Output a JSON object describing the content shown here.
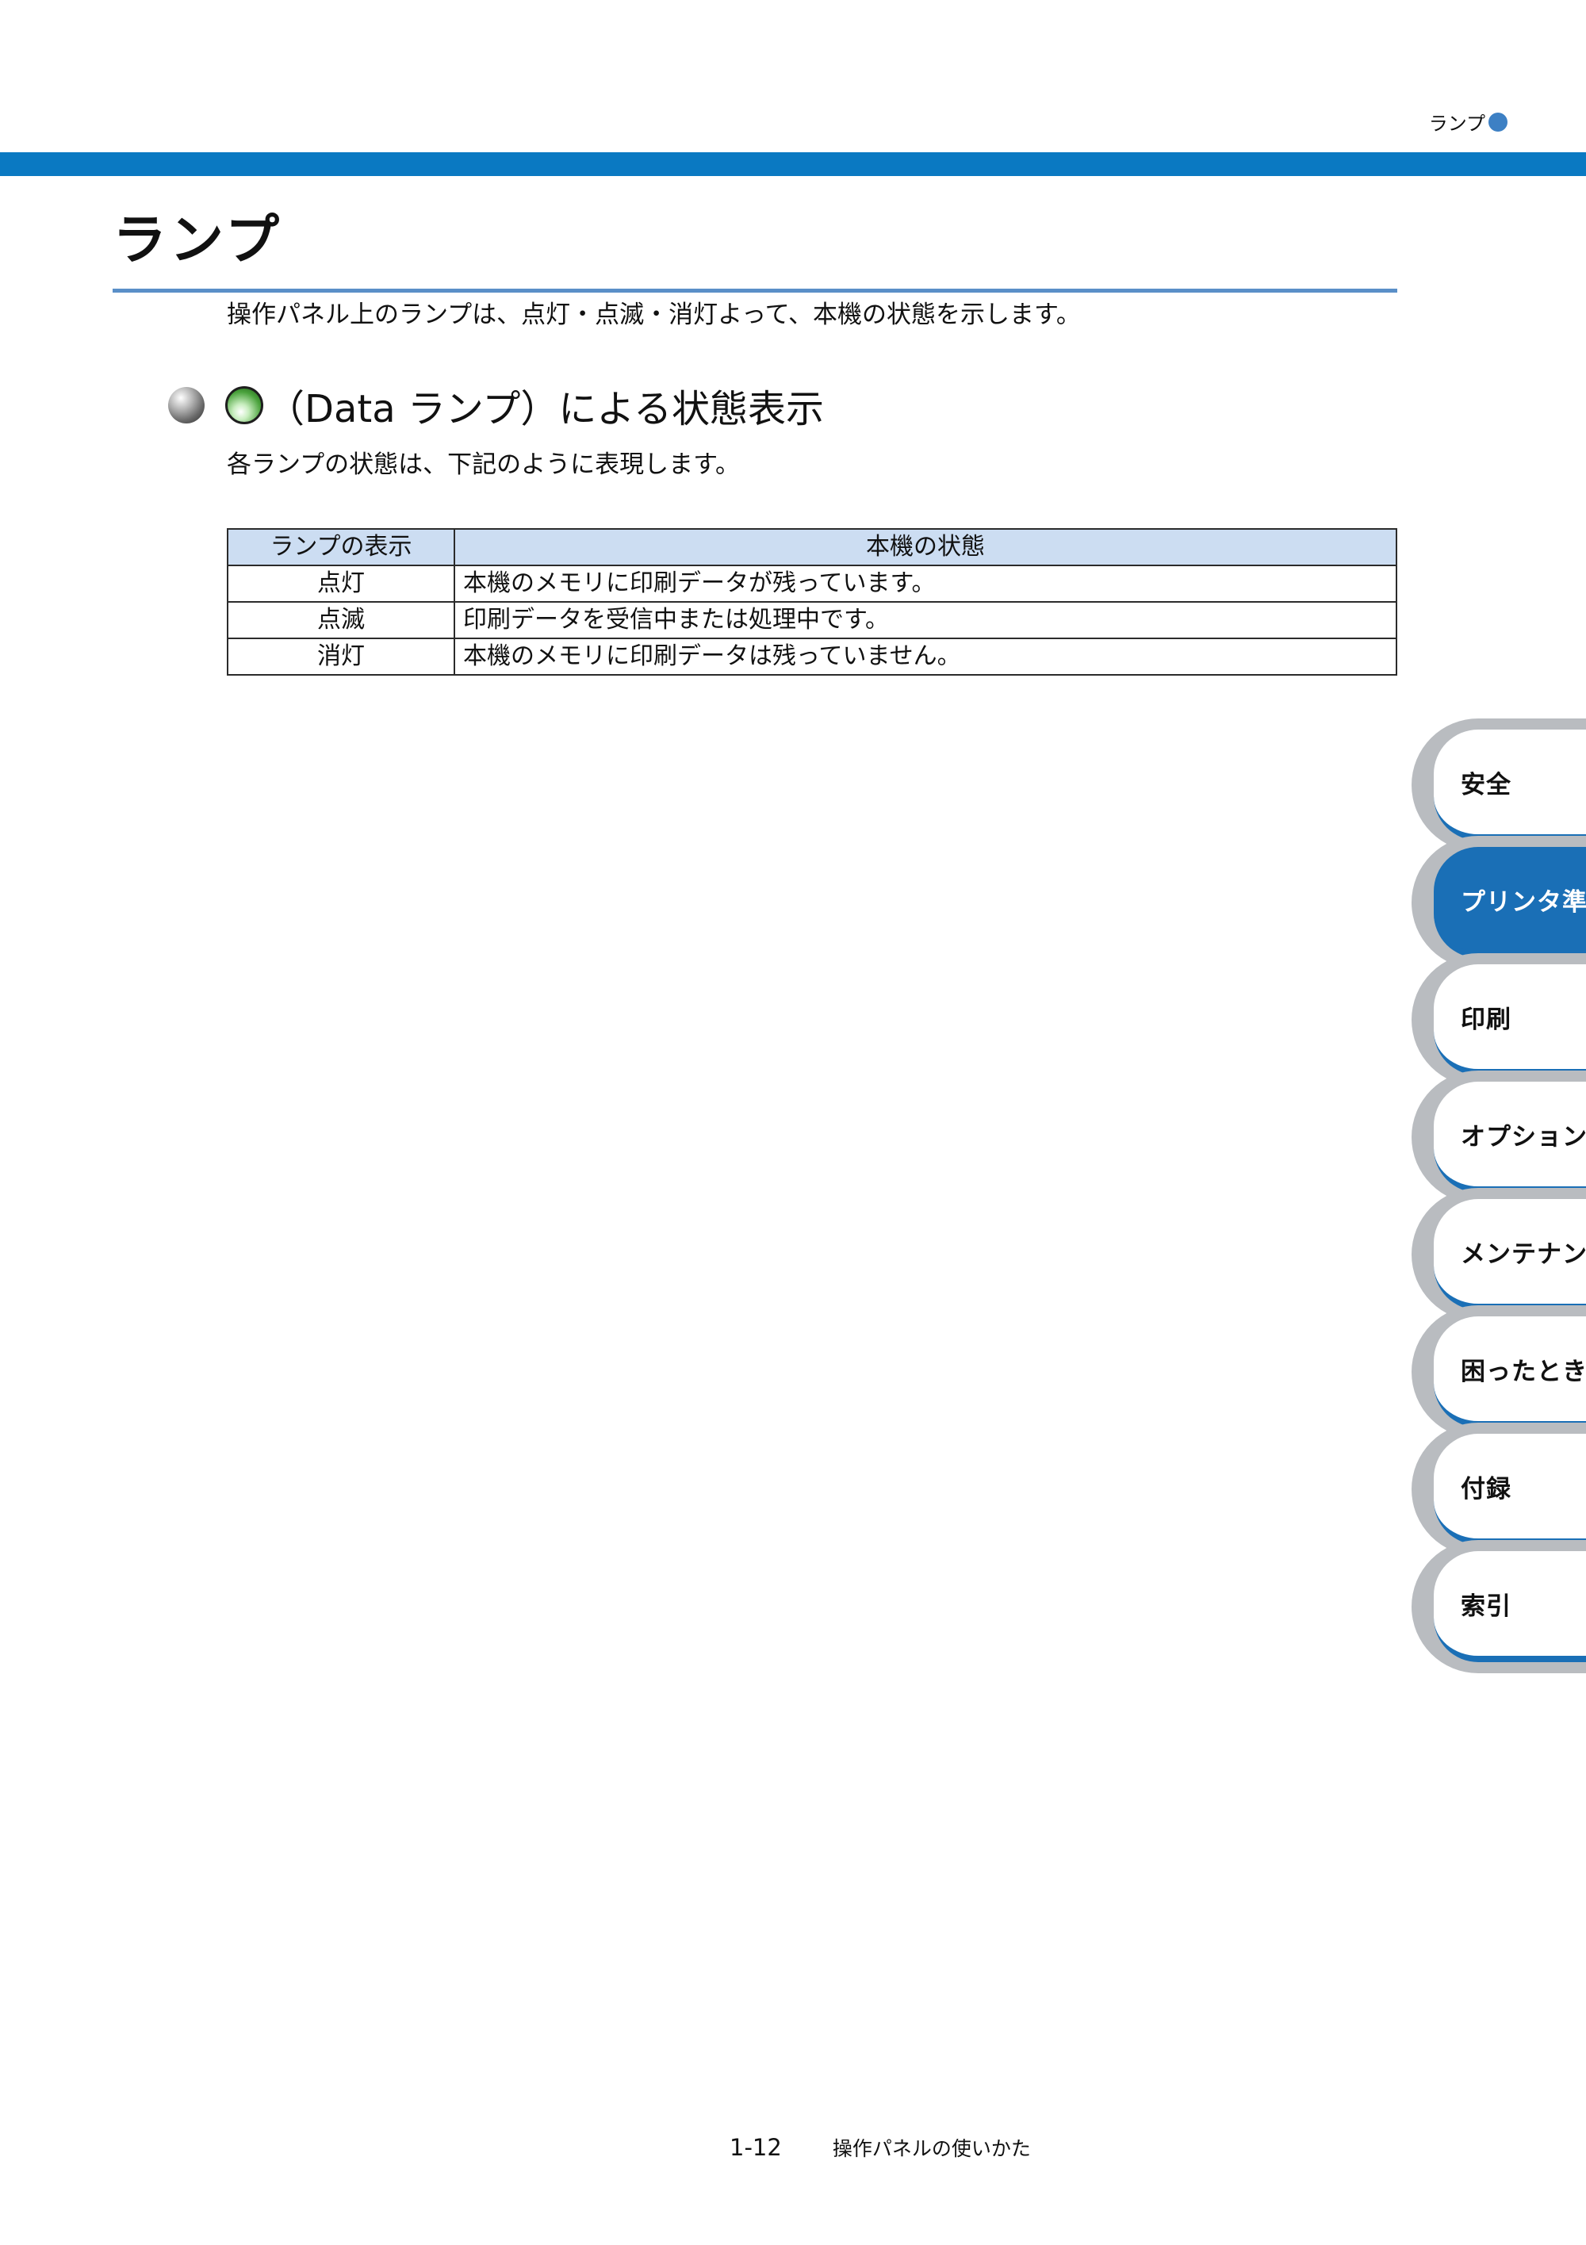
{
  "running_head": {
    "title": "ランプ"
  },
  "page": {
    "title": "ランプ",
    "intro": "操作パネル上のランプは、点灯・点滅・消灯よって、本機の状態を示します。"
  },
  "section": {
    "heading": "（Data ランプ）による状態表示",
    "subtext": "各ランプの状態は、下記のように表現します。"
  },
  "table": {
    "headers": [
      "ランプの表示",
      "本機の状態"
    ],
    "rows": [
      {
        "display": "点灯",
        "state": "本機のメモリに印刷データが残っています。"
      },
      {
        "display": "点滅",
        "state": "印刷データを受信中または処理中です。"
      },
      {
        "display": "消灯",
        "state": "本機のメモリに印刷データは残っていません。"
      }
    ]
  },
  "side_tabs": [
    {
      "label": "安全",
      "active": false
    },
    {
      "label": "プリンタ準備",
      "active": true
    },
    {
      "label": "印刷",
      "active": false
    },
    {
      "label": "オプション",
      "active": false
    },
    {
      "label": "メンテナンス",
      "active": false
    },
    {
      "label": "困ったときは",
      "active": false
    },
    {
      "label": "付録",
      "active": false
    },
    {
      "label": "索引",
      "active": false
    }
  ],
  "footer": {
    "page_number": "1-12",
    "chapter": "操作パネルの使いかた"
  },
  "colors": {
    "accent_blue": "#0a79c2",
    "tab_blue": "#1a6fb6",
    "table_header_bg": "#ccddf2",
    "tab_gray": "#b9bcc0"
  },
  "icons": {
    "running_head": "blue-dot-icon",
    "section_bullet": "gray-sphere-icon",
    "lamp": "green-lamp-icon"
  }
}
